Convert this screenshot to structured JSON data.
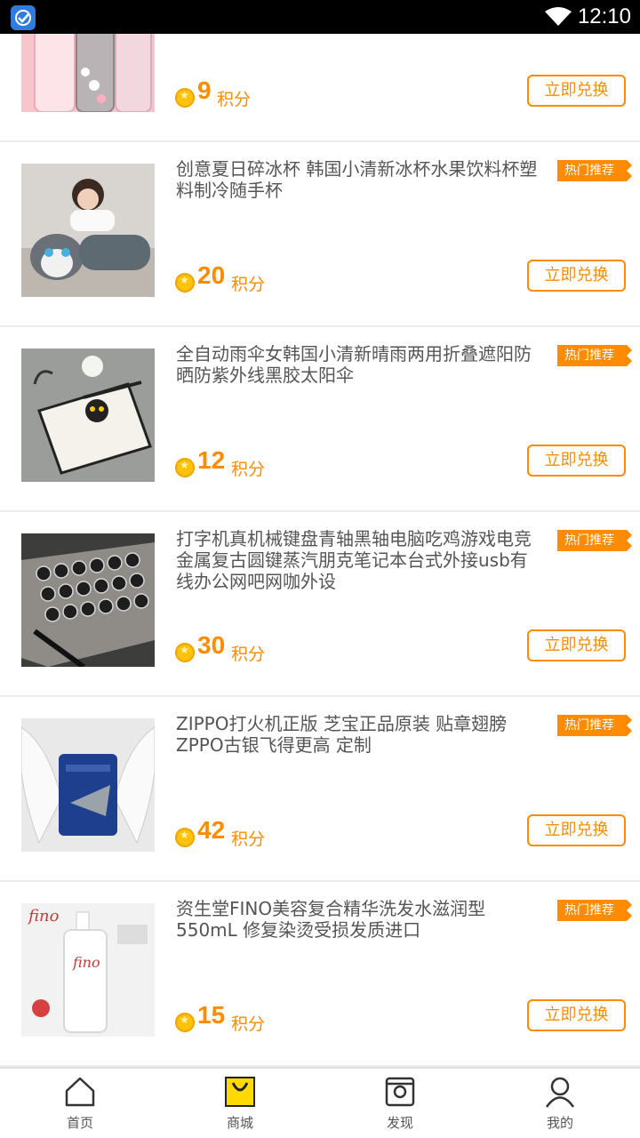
{
  "status_bar": {
    "time": "12:10"
  },
  "products": [
    {
      "title": "",
      "badge": "",
      "points": "9",
      "unit": "积分",
      "button": "立即兑换"
    },
    {
      "title": "创意夏日碎冰杯 韩国小清新冰杯水果饮料杯塑料制冷随手杯",
      "badge": "热门推荐",
      "points": "20",
      "unit": "积分",
      "button": "立即兑换"
    },
    {
      "title": "全自动雨伞女韩国小清新晴雨两用折叠遮阳防晒防紫外线黑胶太阳伞",
      "badge": "热门推荐",
      "points": "12",
      "unit": "积分",
      "button": "立即兑换"
    },
    {
      "title": "打字机真机械键盘青轴黑轴电脑吃鸡游戏电竞金属复古圆键蒸汽朋克笔记本台式外接usb有线办公网吧网咖外设",
      "badge": "热门推荐",
      "points": "30",
      "unit": "积分",
      "button": "立即兑换"
    },
    {
      "title": "ZIPPO打火机正版 芝宝正品原装 贴章翅膀ZPPO古银飞得更高 定制",
      "badge": "热门推荐",
      "points": "42",
      "unit": "积分",
      "button": "立即兑换"
    },
    {
      "title": "资生堂FINO美容复合精华洗发水滋润型550mL 修复染烫受损发质进口",
      "badge": "热门推荐",
      "points": "15",
      "unit": "积分",
      "button": "立即兑换"
    }
  ],
  "tabbar": {
    "home": "首页",
    "mall": "商城",
    "discover": "发现",
    "mine": "我的"
  },
  "colors": {
    "accent": "#ff8c00",
    "tab_active": "#ffd900"
  }
}
